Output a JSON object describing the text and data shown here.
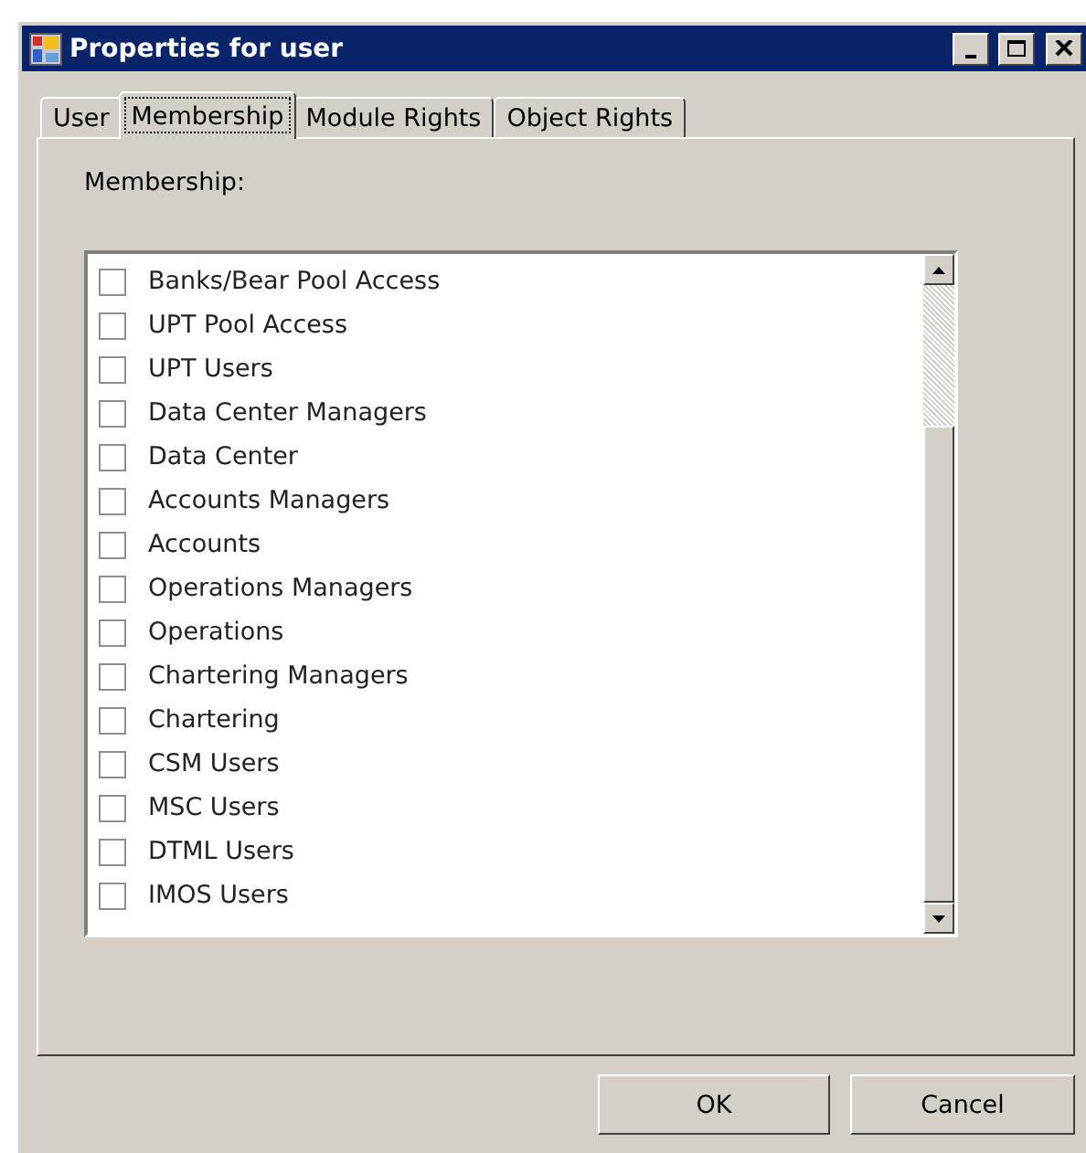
{
  "window": {
    "title": "Properties for user"
  },
  "tabs": [
    {
      "label": "User",
      "selected": false
    },
    {
      "label": "Membership",
      "selected": true
    },
    {
      "label": "Module Rights",
      "selected": false
    },
    {
      "label": "Object Rights",
      "selected": false
    }
  ],
  "membership_label": "Membership:",
  "groups": [
    {
      "name": "Banks/Bear Pool Access",
      "checked": false
    },
    {
      "name": "UPT Pool Access",
      "checked": false
    },
    {
      "name": "UPT Users",
      "checked": false
    },
    {
      "name": "Data Center Managers",
      "checked": false
    },
    {
      "name": "Data Center",
      "checked": false
    },
    {
      "name": "Accounts Managers",
      "checked": false
    },
    {
      "name": "Accounts",
      "checked": false
    },
    {
      "name": "Operations Managers",
      "checked": false
    },
    {
      "name": "Operations",
      "checked": false
    },
    {
      "name": "Chartering Managers",
      "checked": false
    },
    {
      "name": "Chartering",
      "checked": false
    },
    {
      "name": "CSM Users",
      "checked": false
    },
    {
      "name": "MSC Users",
      "checked": false
    },
    {
      "name": "DTML Users",
      "checked": false
    },
    {
      "name": "IMOS Users",
      "checked": false
    }
  ],
  "buttons": [
    "OK",
    "Cancel"
  ]
}
